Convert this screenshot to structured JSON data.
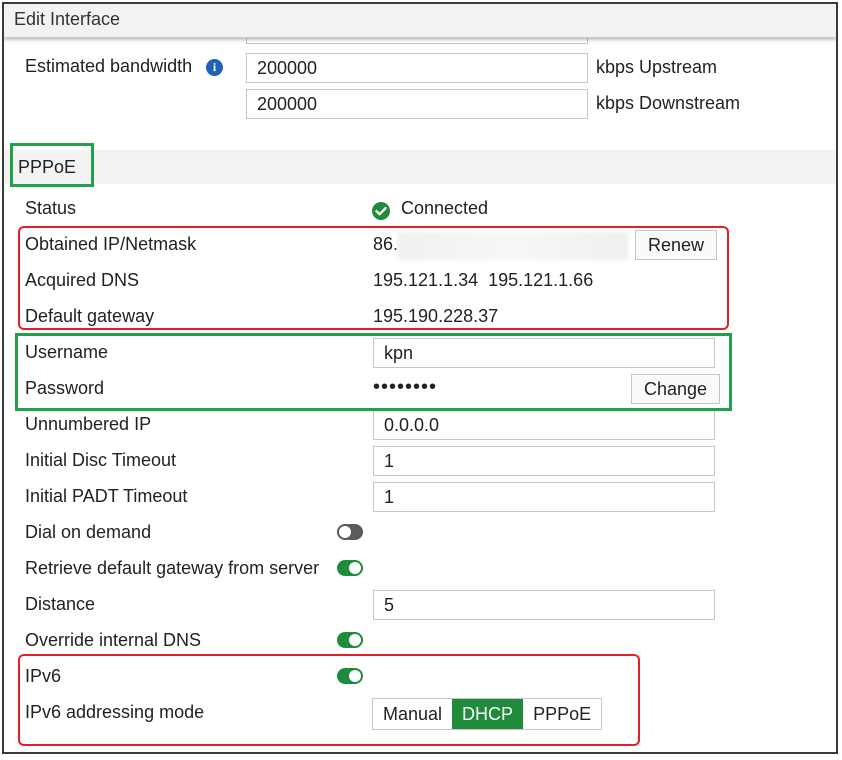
{
  "window": {
    "title": "Edit Interface"
  },
  "bandwidth": {
    "label": "Estimated bandwidth",
    "upstream_value": "200000",
    "upstream_unit": "kbps Upstream",
    "downstream_value": "200000",
    "downstream_unit": "kbps Downstream"
  },
  "pppoe": {
    "section_title": "PPPoE",
    "status_label": "Status",
    "status_value": "Connected",
    "ip_label": "Obtained IP/Netmask",
    "ip_value": "86.",
    "renew_label": "Renew",
    "dns_label": "Acquired DNS",
    "dns_value": "195.121.1.34  195.121.1.66",
    "gateway_label": "Default gateway",
    "gateway_value": "195.190.228.37",
    "username_label": "Username",
    "username_value": "kpn",
    "password_label": "Password",
    "password_value": "••••••••",
    "change_label": "Change",
    "unnumbered_label": "Unnumbered IP",
    "unnumbered_value": "0.0.0.0",
    "disc_timeout_label": "Initial Disc Timeout",
    "disc_timeout_value": "1",
    "padt_timeout_label": "Initial PADT Timeout",
    "padt_timeout_value": "1",
    "dial_label": "Dial on demand",
    "dial_enabled": false,
    "retrieve_gw_label": "Retrieve default gateway from server",
    "retrieve_gw_enabled": true,
    "distance_label": "Distance",
    "distance_value": "5",
    "override_dns_label": "Override internal DNS",
    "override_dns_enabled": true,
    "ipv6_label": "IPv6",
    "ipv6_enabled": true,
    "ipv6_mode_label": "IPv6 addressing mode",
    "ipv6_modes": [
      "Manual",
      "DHCP",
      "PPPoE"
    ],
    "ipv6_mode_selected": "DHCP"
  },
  "colors": {
    "accent_green": "#1f8b3b",
    "highlight_red": "#e0212b",
    "highlight_green": "#22a04b",
    "info_blue": "#1f63b6"
  }
}
